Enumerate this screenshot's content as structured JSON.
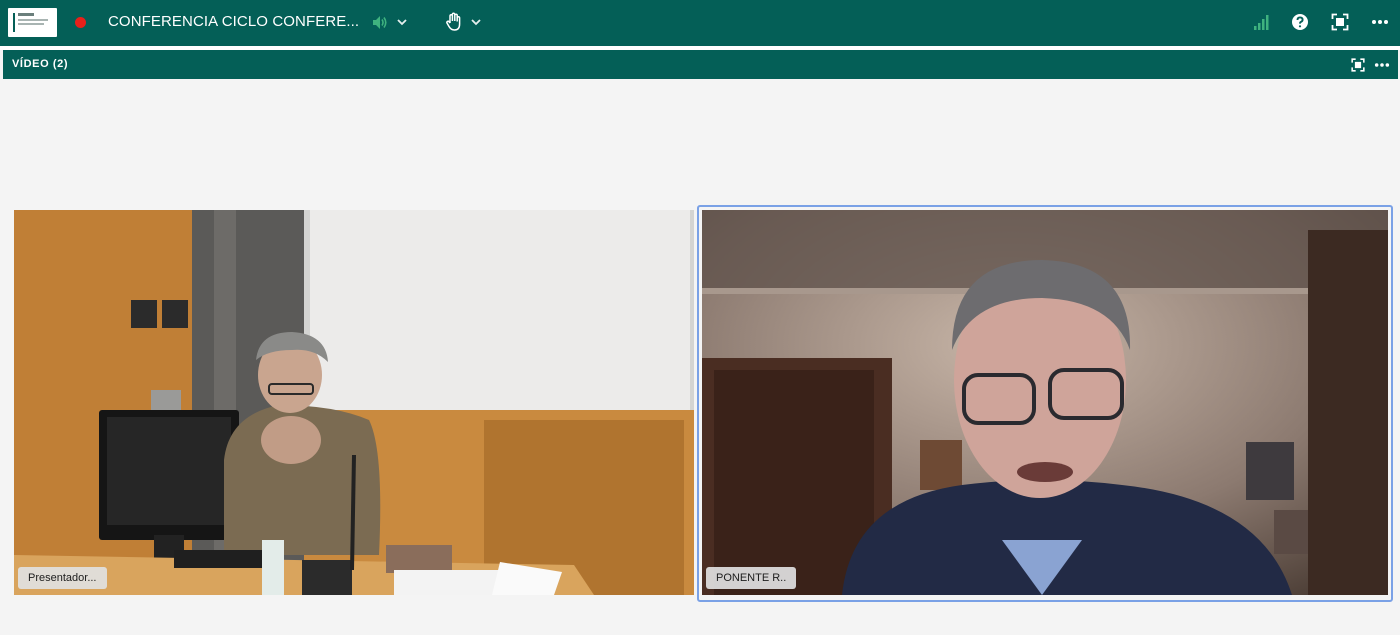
{
  "topbar": {
    "title": "CONFERENCIA CICLO CONFERE...",
    "logo_icon": "institution-logo",
    "record_icon": "recording-dot-icon",
    "record_color": "#e8201a",
    "bar_color": "#045f57",
    "audio_icon": "speaker-volume-icon",
    "audio_icon_color": "#3fb27f",
    "raise_hand_icon": "raise-hand-icon",
    "signal_icon": "connection-signal-icon",
    "help_icon": "help-icon",
    "fullscreen_icon": "fullscreen-icon",
    "more_icon": "more-options-icon"
  },
  "video_panel": {
    "label": "VÍDEO (2)",
    "fullscreen_icon": "fullscreen-icon",
    "more_icon": "more-options-icon"
  },
  "participants": [
    {
      "name": "Presentador...",
      "role": "presenter"
    },
    {
      "name": "PONENTE R..",
      "role": "speaker",
      "highlight_color": "#7aa1e6"
    }
  ]
}
